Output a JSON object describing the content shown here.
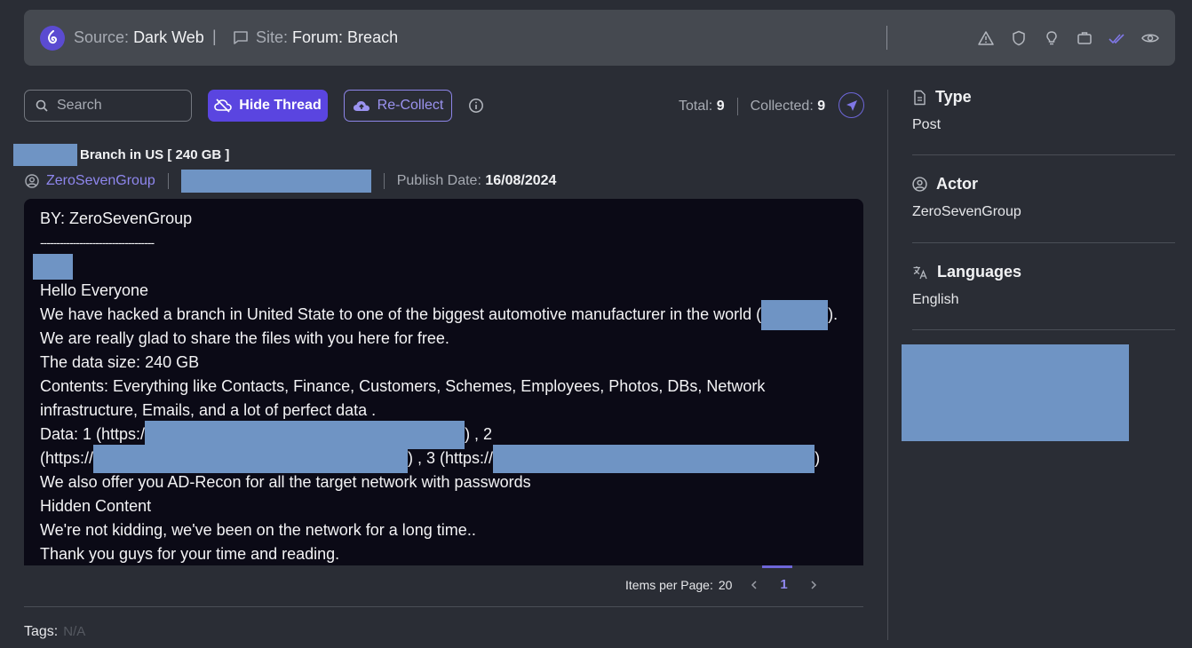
{
  "header": {
    "source_label": "Source:",
    "source_value": "Dark Web",
    "separator": "|",
    "site_label": "Site:",
    "site_value": "Forum: Breach",
    "icons": [
      "alert-triangle-icon",
      "shield-icon",
      "lightbulb-icon",
      "briefcase-icon",
      "double-check-icon",
      "eye-icon"
    ]
  },
  "toolbar": {
    "search_placeholder": "Search",
    "hide_thread_label": "Hide Thread",
    "recollect_label": "Re-Collect",
    "total_label": "Total:",
    "total_value": "9",
    "collected_label": "Collected:",
    "collected_value": "9"
  },
  "post": {
    "title": "Branch in US [ 240 GB ]",
    "actor": "ZeroSevenGroup",
    "publish_label": "Publish Date:",
    "publish_date": "16/08/2024",
    "lines": {
      "l1": "BY:  ZeroSevenGroup",
      "l2": "-----------------------------------",
      "l3": " Hello Everyone",
      "l4a": "We have hacked a branch in United State to one of the biggest automotive manufacturer in the world (",
      "l4b": ").",
      "l5": "We are really glad to share the files with you here for free.",
      "l6": "The data size: 240 GB",
      "l7": "Contents: Everything like Contacts, Finance, Customers, Schemes, Employees, Photos, DBs, Network",
      "l8": "infrastructure, Emails, and a lot of perfect data .",
      "l9a": "Data:  1 (https:/",
      "l9b": ") ,  2",
      "l10a": "(https://",
      "l10b": ") ,  3 (https://",
      "l10c": ")",
      "l11": "We also offer you AD-Recon for all the target network with passwords",
      "l12": "Hidden Content",
      "l13": "We're not kidding, we've been on the network for a long time..",
      "l14": "Thank you guys for your time and reading."
    }
  },
  "pagination": {
    "items_label": "Items per Page:",
    "items_value": "20",
    "current_page": "1"
  },
  "tags": {
    "label": "Tags:",
    "value": "N/A"
  },
  "sidebar": {
    "type_label": "Type",
    "type_value": "Post",
    "actor_label": "Actor",
    "actor_value": "ZeroSevenGroup",
    "languages_label": "Languages",
    "languages_value": "English"
  },
  "colors": {
    "accent": "#5a45e0",
    "accent_text": "#8f87ee",
    "redaction": "#6f94c4",
    "post_background": "#0b0a16"
  }
}
